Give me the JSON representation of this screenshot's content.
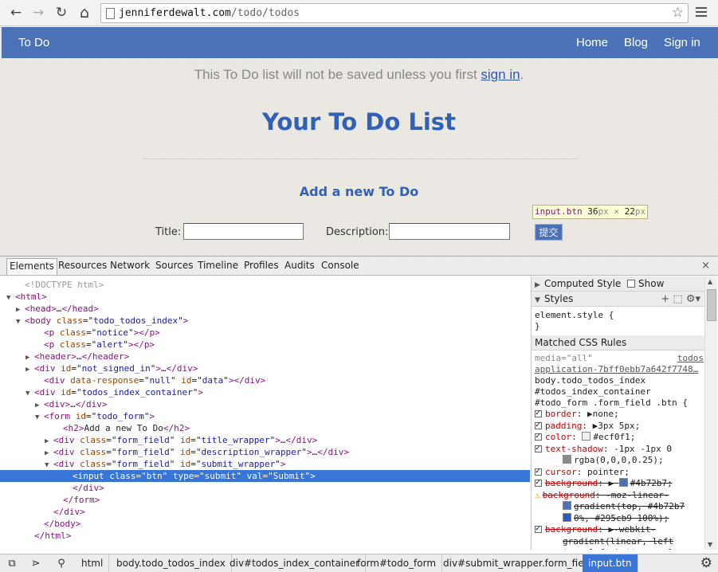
{
  "browser": {
    "url_host": "jenniferdewalt.com",
    "url_path": "/todo/todos",
    "back_icon": "←",
    "forward_icon": "→",
    "reload_icon": "↻",
    "home_icon": "⌂",
    "star_icon": "☆"
  },
  "site": {
    "brand": "To Do",
    "nav": [
      "Home",
      "Blog",
      "Sign in"
    ],
    "notice_prefix": "This To Do list will not be saved unless you first ",
    "notice_link": "sign in",
    "notice_suffix": ".",
    "title": "Your To Do List",
    "form_title": "Add a new To Do",
    "title_label": "Title:",
    "description_label": "Description:",
    "submit_label": "提交",
    "title_value": "",
    "description_value": ""
  },
  "inspector_tooltip": {
    "selector": "input.btn",
    "width": "36",
    "height": "22",
    "unit": "px",
    "times": "×"
  },
  "devtools": {
    "tabs": [
      "Elements",
      "Resources",
      "Network",
      "Sources",
      "Timeline",
      "Profiles",
      "Audits",
      "Console"
    ],
    "active_tab": "Elements",
    "close_icon": "×",
    "tree": [
      {
        "indent": 1,
        "twisty": "",
        "html": "<span class='t-doc'>&lt;!DOCTYPE html&gt;</span>"
      },
      {
        "indent": 0,
        "twisty": "▼",
        "html": "<span class='t-tag'>&lt;html&gt;</span>"
      },
      {
        "indent": 1,
        "twisty": "▶",
        "html": "<span class='t-tag'>&lt;head&gt;</span>…<span class='t-tag'>&lt;/head&gt;</span>"
      },
      {
        "indent": 1,
        "twisty": "▼",
        "html": "<span class='t-tag'>&lt;body </span><span class='t-attr'>class</span>=\"<span class='t-val'>todo_todos_index</span>\"<span class='t-tag'>&gt;</span>"
      },
      {
        "indent": 3,
        "twisty": "",
        "html": "<span class='t-tag'>&lt;p </span><span class='t-attr'>class</span>=\"<span class='t-val'>notice</span>\"<span class='t-tag'>&gt;&lt;/p&gt;</span>"
      },
      {
        "indent": 3,
        "twisty": "",
        "html": "<span class='t-tag'>&lt;p </span><span class='t-attr'>class</span>=\"<span class='t-val'>alert</span>\"<span class='t-tag'>&gt;&lt;/p&gt;</span>"
      },
      {
        "indent": 2,
        "twisty": "▶",
        "html": "<span class='t-tag'>&lt;header&gt;</span>…<span class='t-tag'>&lt;/header&gt;</span>"
      },
      {
        "indent": 2,
        "twisty": "▶",
        "html": "<span class='t-tag'>&lt;div </span><span class='t-attr'>id</span>=\"<span class='t-val'>not_signed_in</span>\"<span class='t-tag'>&gt;</span>…<span class='t-tag'>&lt;/div&gt;</span>"
      },
      {
        "indent": 3,
        "twisty": "",
        "html": "<span class='t-tag'>&lt;div </span><span class='t-attr'>data-response</span>=\"<span class='t-val'>null</span>\" <span class='t-attr'>id</span>=\"<span class='t-val'>data</span>\"<span class='t-tag'>&gt;&lt;/div&gt;</span>"
      },
      {
        "indent": 2,
        "twisty": "▼",
        "html": "<span class='t-tag'>&lt;div </span><span class='t-attr'>id</span>=\"<span class='t-val'>todos_index_container</span>\"<span class='t-tag'>&gt;</span>"
      },
      {
        "indent": 3,
        "twisty": "▶",
        "html": "<span class='t-tag'>&lt;div&gt;</span>…<span class='t-tag'>&lt;/div&gt;</span>"
      },
      {
        "indent": 3,
        "twisty": "▼",
        "html": "<span class='t-tag'>&lt;form </span><span class='t-attr'>id</span>=\"<span class='t-val'>todo_form</span>\"<span class='t-tag'>&gt;</span>"
      },
      {
        "indent": 5,
        "twisty": "",
        "html": "<span class='t-tag'>&lt;h2&gt;</span><span class='t-text'>Add a new To Do</span><span class='t-tag'>&lt;/h2&gt;</span>"
      },
      {
        "indent": 4,
        "twisty": "▶",
        "html": "<span class='t-tag'>&lt;div </span><span class='t-attr'>class</span>=\"<span class='t-val'>form_field</span>\" <span class='t-attr'>id</span>=\"<span class='t-val'>title_wrapper</span>\"<span class='t-tag'>&gt;</span>…<span class='t-tag'>&lt;/div&gt;</span>"
      },
      {
        "indent": 4,
        "twisty": "▶",
        "html": "<span class='t-tag'>&lt;div </span><span class='t-attr'>class</span>=\"<span class='t-val'>form_field</span>\" <span class='t-attr'>id</span>=\"<span class='t-val'>description_wrapper</span>\"<span class='t-tag'>&gt;</span>…<span class='t-tag'>&lt;/div&gt;</span>"
      },
      {
        "indent": 4,
        "twisty": "▼",
        "html": "<span class='t-tag'>&lt;div </span><span class='t-attr'>class</span>=\"<span class='t-val'>form_field</span>\" <span class='t-attr'>id</span>=\"<span class='t-val'>submit_wrapper</span>\"<span class='t-tag'>&gt;</span>"
      },
      {
        "indent": 6,
        "twisty": "",
        "sel": true,
        "html": "<span class='t-tag'>&lt;input </span><span class='t-attr'>class</span>=\"<span class='t-val'>btn</span>\" <span class='t-attr'>type</span>=\"<span class='t-val'>submit</span>\" <span class='t-attr'>val</span>=\"<span class='t-val'>Submit</span>\"<span class='t-tag'>&gt;</span>"
      },
      {
        "indent": 6,
        "twisty": "",
        "html": "<span class='t-tag'>&lt;/div&gt;</span>"
      },
      {
        "indent": 5,
        "twisty": "",
        "html": "<span class='t-tag'>&lt;/form&gt;</span>"
      },
      {
        "indent": 4,
        "twisty": "",
        "html": "<span class='t-tag'>&lt;/div&gt;</span>"
      },
      {
        "indent": 3,
        "twisty": "",
        "html": "<span class='t-tag'>&lt;/body&gt;</span>"
      },
      {
        "indent": 2,
        "twisty": "",
        "html": "<span class='t-tag'>&lt;/html&gt;</span>"
      }
    ],
    "sidebar": {
      "computed_style": "Computed Style",
      "show_inherited": "Show inherited",
      "styles": "Styles",
      "element_style_open": "element.style {",
      "element_style_close": "}",
      "matched_rules": "Matched CSS Rules",
      "media": "media=\"all\"",
      "source_link": "todos",
      "source_file": "application-7bff0ebb7a642f7748…",
      "selector_lines": [
        "body.todo_todos_index",
        "#todos_index_container",
        "#todo_form .form_field .btn {"
      ],
      "declarations": [
        {
          "prop": "border",
          "value": "▶none;",
          "strike": false,
          "checked": true
        },
        {
          "prop": "padding",
          "value": "▶3px 5px;",
          "strike": false,
          "checked": true
        },
        {
          "prop": "color",
          "value": "#ecf0f1;",
          "swatch": "#ecf0f1",
          "strike": false,
          "checked": true
        },
        {
          "prop": "text-shadow",
          "value": "-1px -1px 0",
          "strike": false,
          "checked": true
        },
        {
          "prop": "",
          "value": "rgba(0,0,0,0.25);",
          "swatch": "#8a8a8a",
          "strike": false,
          "checked": false,
          "continued": true
        },
        {
          "prop": "cursor",
          "value": "pointer;",
          "strike": false,
          "checked": true
        },
        {
          "prop": "background",
          "value": "▶ #4b72b7;",
          "swatch": "#4b72b7",
          "strike": true,
          "checked": true
        },
        {
          "prop": "background",
          "value": "-moz-linear-",
          "strike": true,
          "checked": false,
          "warning": true
        },
        {
          "prop": "",
          "value": "gradient(top, #4b72b7",
          "swatch": "#4b72b7",
          "strike": true,
          "checked": false,
          "continued": true
        },
        {
          "prop": "",
          "value": "0%, #295cb9 100%);",
          "swatch": "#295cb9",
          "strike": true,
          "checked": false,
          "continued": true
        },
        {
          "prop": "background",
          "value": "▶-webkit-",
          "strike": true,
          "checked": true
        },
        {
          "prop": "",
          "value": "gradient(linear, left",
          "strike": true,
          "checked": false,
          "continued": true
        },
        {
          "prop": "",
          "value": "top, left bottom, color",
          "strike": true,
          "checked": false,
          "continued": true
        }
      ]
    },
    "breadcrumbs": [
      "html",
      "body.todo_todos_index",
      "div#todos_index_container",
      "form#todo_form",
      "div#submit_wrapper.form_field",
      "input.btn"
    ],
    "active_crumb": "input.btn",
    "settings_icon": "⚙"
  },
  "colors": {
    "brand_blue": "#4b72b7",
    "selection_blue": "#3875d7",
    "heading_blue": "#3060b8"
  }
}
